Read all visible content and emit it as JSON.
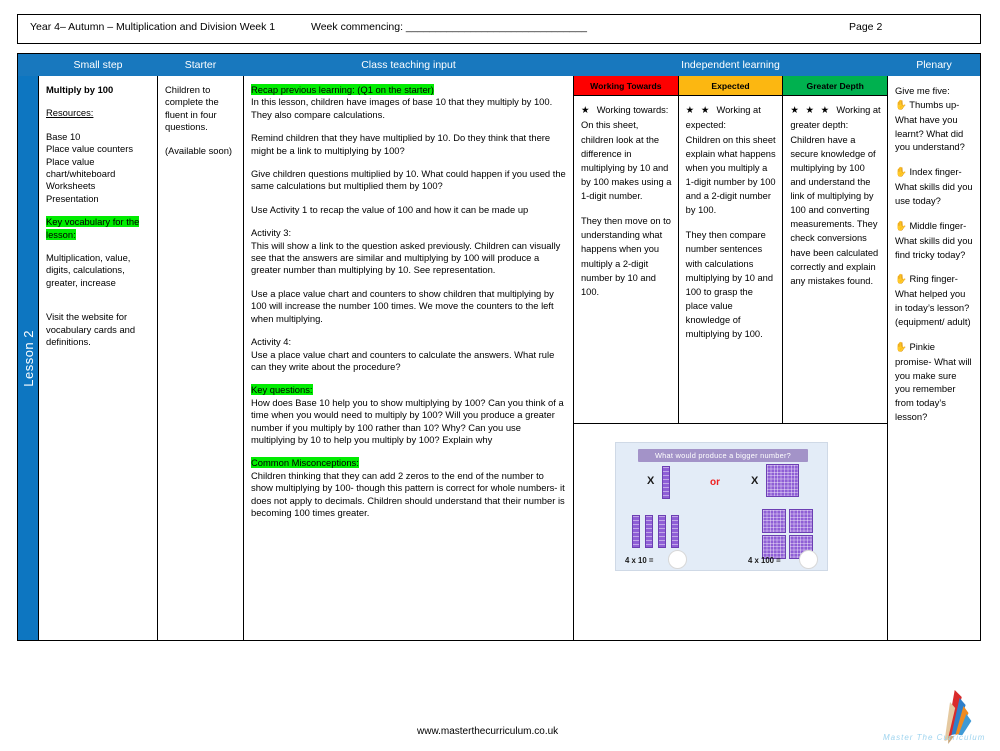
{
  "header": {
    "title": "Year 4– Autumn – Multiplication and Division Week 1",
    "week_commencing": "Week commencing: _______________________________",
    "page": "Page 2"
  },
  "table_headers": {
    "small_step": "Small step",
    "starter": "Starter",
    "class_teaching_input": "Class teaching input",
    "independent_learning": "Independent learning",
    "plenary": "Plenary"
  },
  "spine": {
    "label": "Lesson 2"
  },
  "small_step": {
    "title": "Multiply by 100",
    "resources_label": "Resources:",
    "resources": "Base 10\nPlace value counters\nPlace value chart/whiteboard\nWorksheets\nPresentation",
    "key_vocab_label": "Key vocabulary for the lesson:",
    "key_vocab": "Multiplication, value, digits, calculations, greater, increase",
    "website_note": "Visit the website for vocabulary cards and definitions."
  },
  "starter": {
    "text": "Children to complete the fluent in four questions.",
    "availability": "(Available soon)"
  },
  "class_teaching": {
    "recap_label": "Recap previous learning: (Q1 on the starter)",
    "p1": "In this lesson, children have images of base 10 that they multiply by 100. They also compare calculations.",
    "p2": "Remind children that they have multiplied by 10. Do they think that there might be a link to multiplying by 100?",
    "p3": "Give children questions multiplied by 10. What could happen if you used the same calculations but multiplied them by 100?",
    "p4": "Use Activity 1 to recap the value of 100 and how it can be made up",
    "activity3_label": "Activity 3:",
    "activity3": "This will show a link to the question asked previously. Children can visually see that the answers are similar and multiplying by 100 will produce a greater number than multiplying by 10. See representation.",
    "p5": "Use a place value chart and counters to show children that multiplying by 100 will increase the number 100 times. We move the counters to the left when multiplying.",
    "activity4_label": "Activity 4:",
    "activity4": "Use a place value chart and counters to calculate the answers. What rule can they write about the procedure?",
    "key_questions_label": "Key questions:",
    "key_questions": "How does Base 10 help you to show multiplying by 100? Can you think of a time when you would need to  multiply by 100? Will you produce a greater number if you multiply by 100 rather than 10? Why? Can you  use multiplying by 10 to help you multiply by 100? Explain why",
    "misconceptions_label": "Common Misconceptions:",
    "misconceptions": "Children thinking that they can add 2 zeros to the end of the number to show multiplying by 100- though this pattern is correct for whole numbers- it does not apply to decimals. Children should understand that their number is becoming 100 times greater."
  },
  "independent": {
    "columns": [
      {
        "label": "Working Towards",
        "color": "#fe0000",
        "stars": "★",
        "heading": "Working towards:",
        "body": "On this sheet, children look at the difference in multiplying by 10 and by 100 makes using a 1-digit number.",
        "body2": "They then move on to understanding what happens when you  multiply a 2-digit number by 10 and 100."
      },
      {
        "label": "Expected",
        "color": "#fcb711",
        "stars": "★ ★",
        "heading": "Working at expected:",
        "body": "Children on this sheet explain what happens when you multiply a 1-digit number by 100 and a 2-digit number by 100.",
        "body2": "They then compare number sentences with calculations multiplying by 10 and 100 to grasp the place value knowledge of multiplying by 100."
      },
      {
        "label": "Greater Depth",
        "color": "#00b14f",
        "stars": "★ ★ ★",
        "heading": "Working at greater depth:",
        "body": "Children have a secure knowledge of multiplying by 100 and understand the link of multiplying by 100 and converting measurements. They check conversions have been calculated correctly and explain any mistakes found.",
        "body2": ""
      }
    ]
  },
  "representation": {
    "title": "What would produce a bigger number?",
    "x_left": "X",
    "or": "or",
    "x_right": "X",
    "eq_left": "4 x 10 =",
    "eq_right": "4 x 100 ="
  },
  "plenary": {
    "intro": "Give me five:",
    "items": [
      {
        "icon": "hand-icon",
        "text": "Thumbs up- What have you learnt? What did you understand?"
      },
      {
        "icon": "hand-icon",
        "text": "Index finger- What skills did you use today?"
      },
      {
        "icon": "hand-icon",
        "text": "Middle finger- What skills did you find tricky today?"
      },
      {
        "icon": "hand-icon",
        "text": "Ring finger- What helped you in today’s lesson? (equipment/ adult)"
      },
      {
        "icon": "hand-icon",
        "text": "Pinkie promise- What will you make sure you remember from today’s lesson?"
      }
    ]
  },
  "footer": {
    "url": "www.masterthecurriculum.co.uk",
    "logo_wordmark": "Master The Curriculum"
  }
}
